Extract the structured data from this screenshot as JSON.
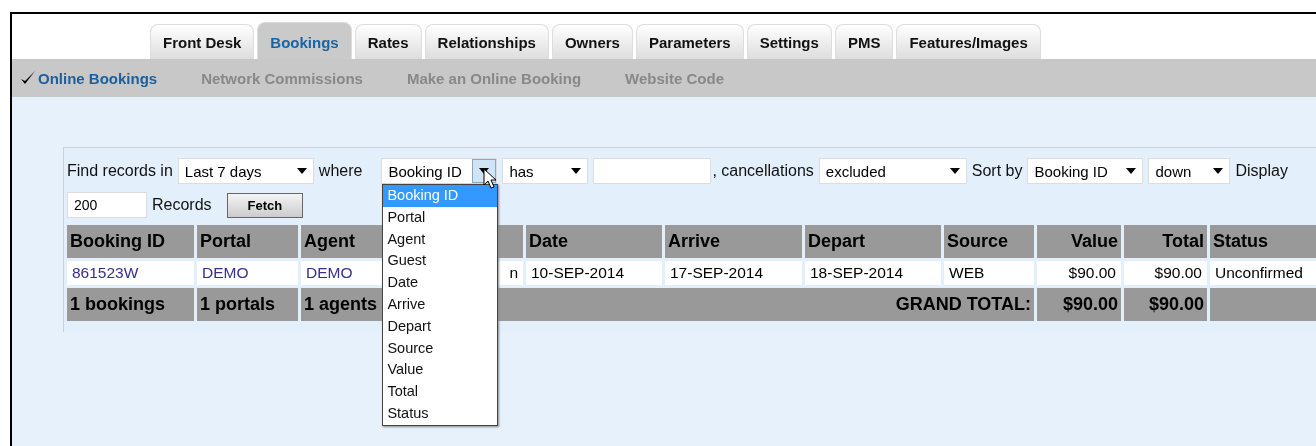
{
  "tabs": [
    {
      "label": "Front Desk",
      "selected": false
    },
    {
      "label": "Bookings",
      "selected": true
    },
    {
      "label": "Rates",
      "selected": false
    },
    {
      "label": "Relationships",
      "selected": false
    },
    {
      "label": "Owners",
      "selected": false
    },
    {
      "label": "Parameters",
      "selected": false
    },
    {
      "label": "Settings",
      "selected": false
    },
    {
      "label": "PMS",
      "selected": false
    },
    {
      "label": "Features/Images",
      "selected": false
    }
  ],
  "subnav": [
    {
      "label": "Online Bookings",
      "selected": true
    },
    {
      "label": "Network Commissions",
      "selected": false
    },
    {
      "label": "Make an Online Booking",
      "selected": false
    },
    {
      "label": "Website Code",
      "selected": false
    }
  ],
  "filters": {
    "find_label": "Find records in",
    "period": "Last 7 days",
    "where_label": "where",
    "field": "Booking ID",
    "operator": "has",
    "cancellations_label": ", cancellations",
    "cancellations": "excluded",
    "sort_label": "Sort by",
    "sort_field": "Booking ID",
    "sort_direction": "down",
    "display_label": "Display",
    "limit": "200",
    "records_label": "Records",
    "fetch_button": "Fetch"
  },
  "field_dropdown": {
    "options": [
      {
        "label": "Booking ID",
        "selected": true
      },
      {
        "label": "Portal",
        "selected": false
      },
      {
        "label": "Agent",
        "selected": false
      },
      {
        "label": "Guest",
        "selected": false
      },
      {
        "label": "Date",
        "selected": false
      },
      {
        "label": "Arrive",
        "selected": false
      },
      {
        "label": "Depart",
        "selected": false
      },
      {
        "label": "Source",
        "selected": false
      },
      {
        "label": "Value",
        "selected": false
      },
      {
        "label": "Total",
        "selected": false
      },
      {
        "label": "Status",
        "selected": false
      }
    ]
  },
  "table": {
    "columns": [
      {
        "label": "Booking ID",
        "kind": "text"
      },
      {
        "label": "Portal",
        "kind": "text"
      },
      {
        "label": "Agent",
        "kind": "text"
      },
      {
        "kind": "hidden"
      },
      {
        "label": "Date",
        "kind": "text"
      },
      {
        "label": "Arrive",
        "kind": "text"
      },
      {
        "label": "Depart",
        "kind": "text"
      },
      {
        "label": "Source",
        "kind": "text"
      },
      {
        "label": "Value",
        "kind": "money"
      },
      {
        "label": "Total",
        "kind": "money"
      },
      {
        "label": "Status",
        "kind": "text"
      }
    ],
    "rows": [
      {
        "cells": [
          {
            "text": "861523W",
            "kind": "link"
          },
          {
            "text": "DEMO",
            "kind": "link"
          },
          {
            "text": "DEMO",
            "kind": "link"
          },
          {
            "text": "n",
            "kind": "covered"
          },
          {
            "text": "10-SEP-2014",
            "kind": "plain"
          },
          {
            "text": "17-SEP-2014",
            "kind": "plain"
          },
          {
            "text": "18-SEP-2014",
            "kind": "plain"
          },
          {
            "text": "WEB",
            "kind": "plain"
          },
          {
            "text": "$90.00",
            "kind": "plain"
          },
          {
            "text": "$90.00",
            "kind": "plain"
          },
          {
            "text": "Unconfirmed",
            "kind": "plain"
          }
        ]
      }
    ],
    "footer": {
      "counts": [
        "1 bookings",
        "1 portals",
        "1 agents"
      ],
      "grand_total_label": "GRAND TOTAL:",
      "totals": [
        "$90.00",
        "$90.00"
      ]
    }
  }
}
